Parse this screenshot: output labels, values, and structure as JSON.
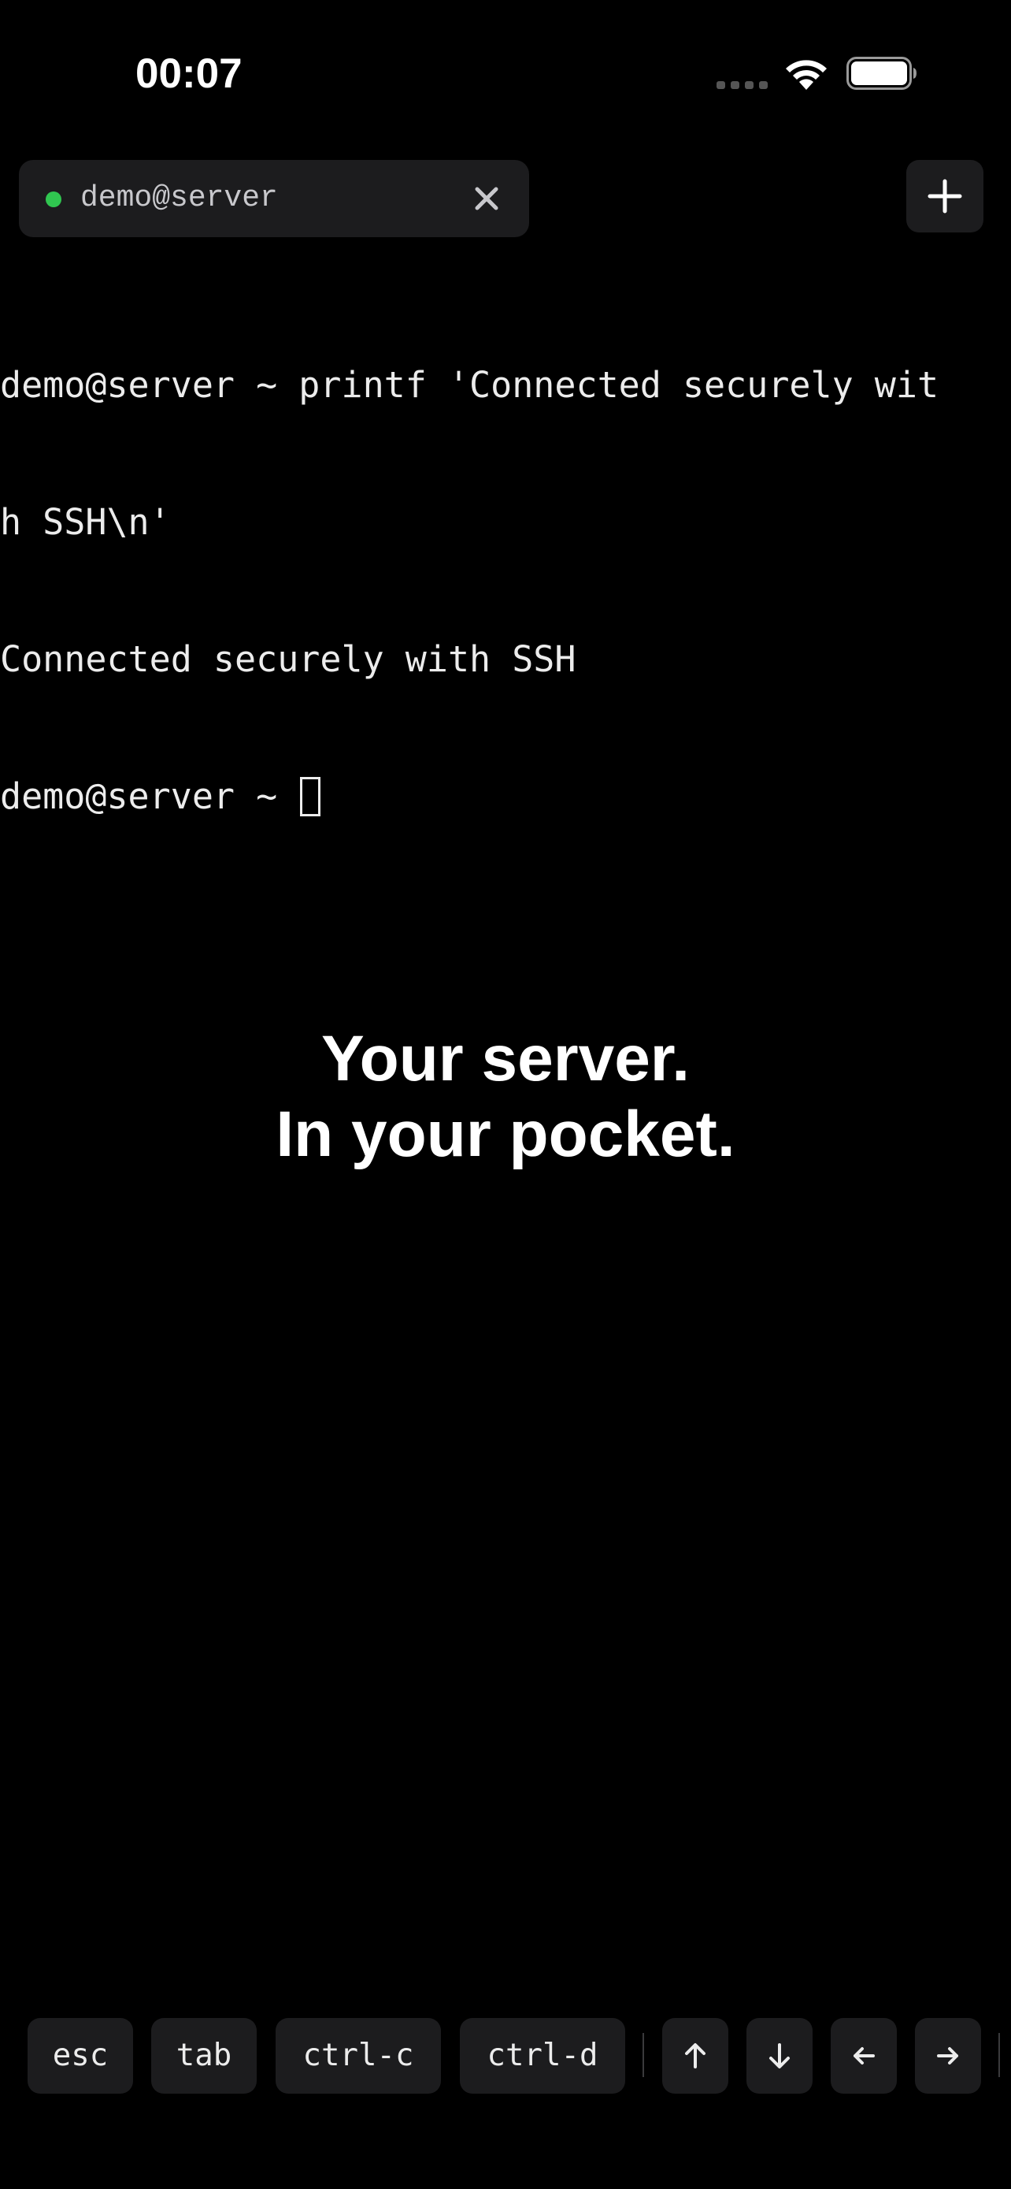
{
  "status_bar": {
    "time": "00:07",
    "icons": [
      "cellular-signal-icon",
      "wifi-icon",
      "battery-icon"
    ]
  },
  "tab": {
    "label": "demo@server",
    "status_color": "#30c650",
    "icons": [
      "connection-status-dot",
      "close-icon"
    ]
  },
  "new_tab": {
    "icon": "plus-icon"
  },
  "terminal": {
    "lines": [
      "demo@server ~ printf 'Connected securely wit",
      "h SSH\\n'",
      "Connected securely with SSH",
      "demo@server ~ "
    ]
  },
  "tagline": {
    "line1": "Your server.",
    "line2": "In your pocket."
  },
  "accessory_keys": {
    "esc": "esc",
    "tab": "tab",
    "ctrl_c": "ctrl-c",
    "ctrl_d": "ctrl-d",
    "arrow_icons": [
      "arrow-up-icon",
      "arrow-down-icon",
      "arrow-left-icon",
      "arrow-right-icon"
    ]
  },
  "colors": {
    "background": "#000000",
    "surface": "#1c1c1e",
    "text": "#ececec",
    "accent_green": "#30c650"
  }
}
